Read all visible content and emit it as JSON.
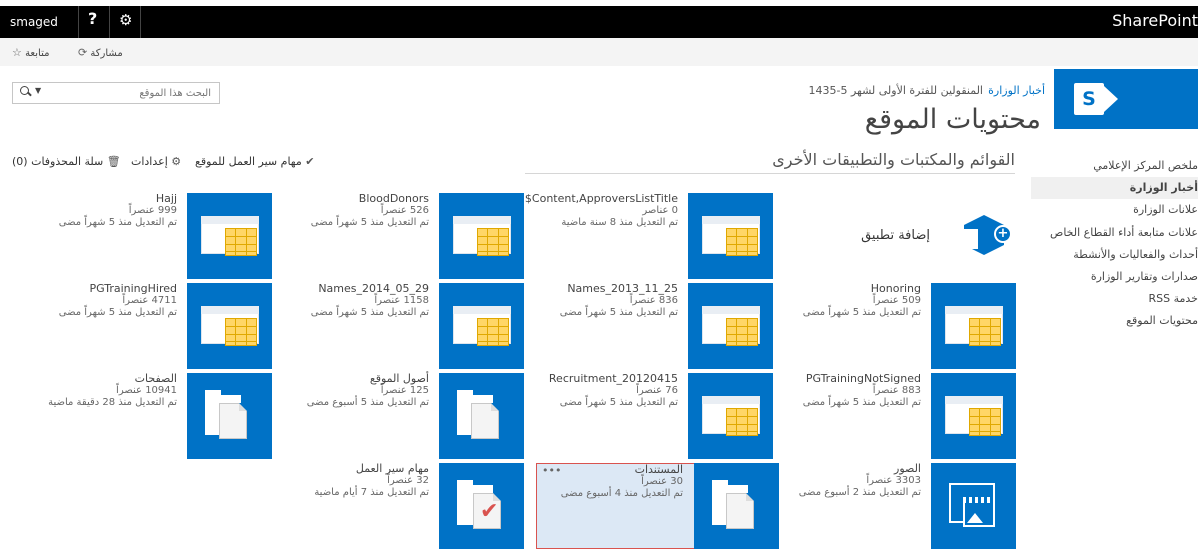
{
  "suite": {
    "user": "smaged",
    "help": "?",
    "gear": "⚙",
    "brand": "SharePoint"
  },
  "ribbon": {
    "share": "مشاركة",
    "follow": "متابعة"
  },
  "search": {
    "placeholder": "البحث هذا الموقع"
  },
  "header": {
    "active_link": "أخبار الوزارة",
    "second_link": "المنقولين للفترة الأولى لشهر 5-1435",
    "title": "محتويات الموقع"
  },
  "toolbar": {
    "tasks": "مهام سير العمل للموقع",
    "settings": "إعدادات",
    "recycle": "سلة المحذوفات (0)"
  },
  "section_title": "القوائم والمكتبات والتطبيقات الأخرى",
  "nav": [
    "ملخص المركز الإعلامي",
    "أخبار الوزارة",
    "علانات الوزارة",
    "علانات متابعة أداء القطاع الخاص",
    "أحداث والفعاليات والأنشطة",
    "صدارات وتقارير الوزارة",
    "خدمة RSS",
    "محتويات الموقع"
  ],
  "add_app": "إضافة تطبيق",
  "tiles": {
    "content_approvers": {
      "name": "Content,ApproversListTitle$",
      "count": "0 عناصر",
      "modified": "تم التعديل منذ 8 سنة ماضية"
    },
    "blood_donors": {
      "name": "BloodDonors",
      "count": "526 عنصراً",
      "modified": "تم التعديل منذ 5 شهراً مضى"
    },
    "hajj": {
      "name": "Hajj",
      "count": "999 عنصراً",
      "modified": "تم التعديل منذ 5 شهراً مضى"
    },
    "honoring": {
      "name": "Honoring",
      "count": "509 عنصراً",
      "modified": "تم التعديل منذ 5 شهراً مضى"
    },
    "names_2013": {
      "name": "Names_2013_11_25",
      "count": "836 عنصراً",
      "modified": "تم التعديل منذ 5 شهراً مضى"
    },
    "names_2014": {
      "name": "Names_2014_05_29",
      "count": "1158 عنصراً",
      "modified": "تم التعديل منذ 5 شهراً مضى"
    },
    "pg_hired": {
      "name": "PGTrainingHired",
      "count": "4711 عنصراً",
      "modified": "تم التعديل منذ 5 شهراً مضى"
    },
    "pg_not_signed": {
      "name": "PGTrainingNotSigned",
      "count": "883 عنصراً",
      "modified": "تم التعديل منذ 5 شهراً مضى"
    },
    "recruitment": {
      "name": "Recruitment_20120415",
      "count": "76 عنصراً",
      "modified": "تم التعديل منذ 5 شهراً مضى"
    },
    "site_assets": {
      "name": "أصول الموقع",
      "count": "125 عنصراً",
      "modified": "تم التعديل منذ 5 أسبوع مضى"
    },
    "pages": {
      "name": "الصفحات",
      "count": "10941 عنصراً",
      "modified": "تم التعديل منذ 28 دقيقة ماضية"
    },
    "pictures": {
      "name": "الصور",
      "count": "3303 عنصراً",
      "modified": "تم التعديل منذ 2 أسبوع مضى"
    },
    "documents": {
      "name": "المستندات",
      "count": "30 عنصراً",
      "modified": "تم التعديل منذ 4 أسبوع مضى",
      "ellipsis": "•••"
    },
    "workflow_tasks": {
      "name": "مهام سير العمل",
      "count": "32 عنصراً",
      "modified": "تم التعديل منذ 7 أيام ماضية"
    }
  },
  "colors": {
    "accent": "#0072c6",
    "selection_border": "#d9534f",
    "selection_fill": "#dce8f5"
  }
}
